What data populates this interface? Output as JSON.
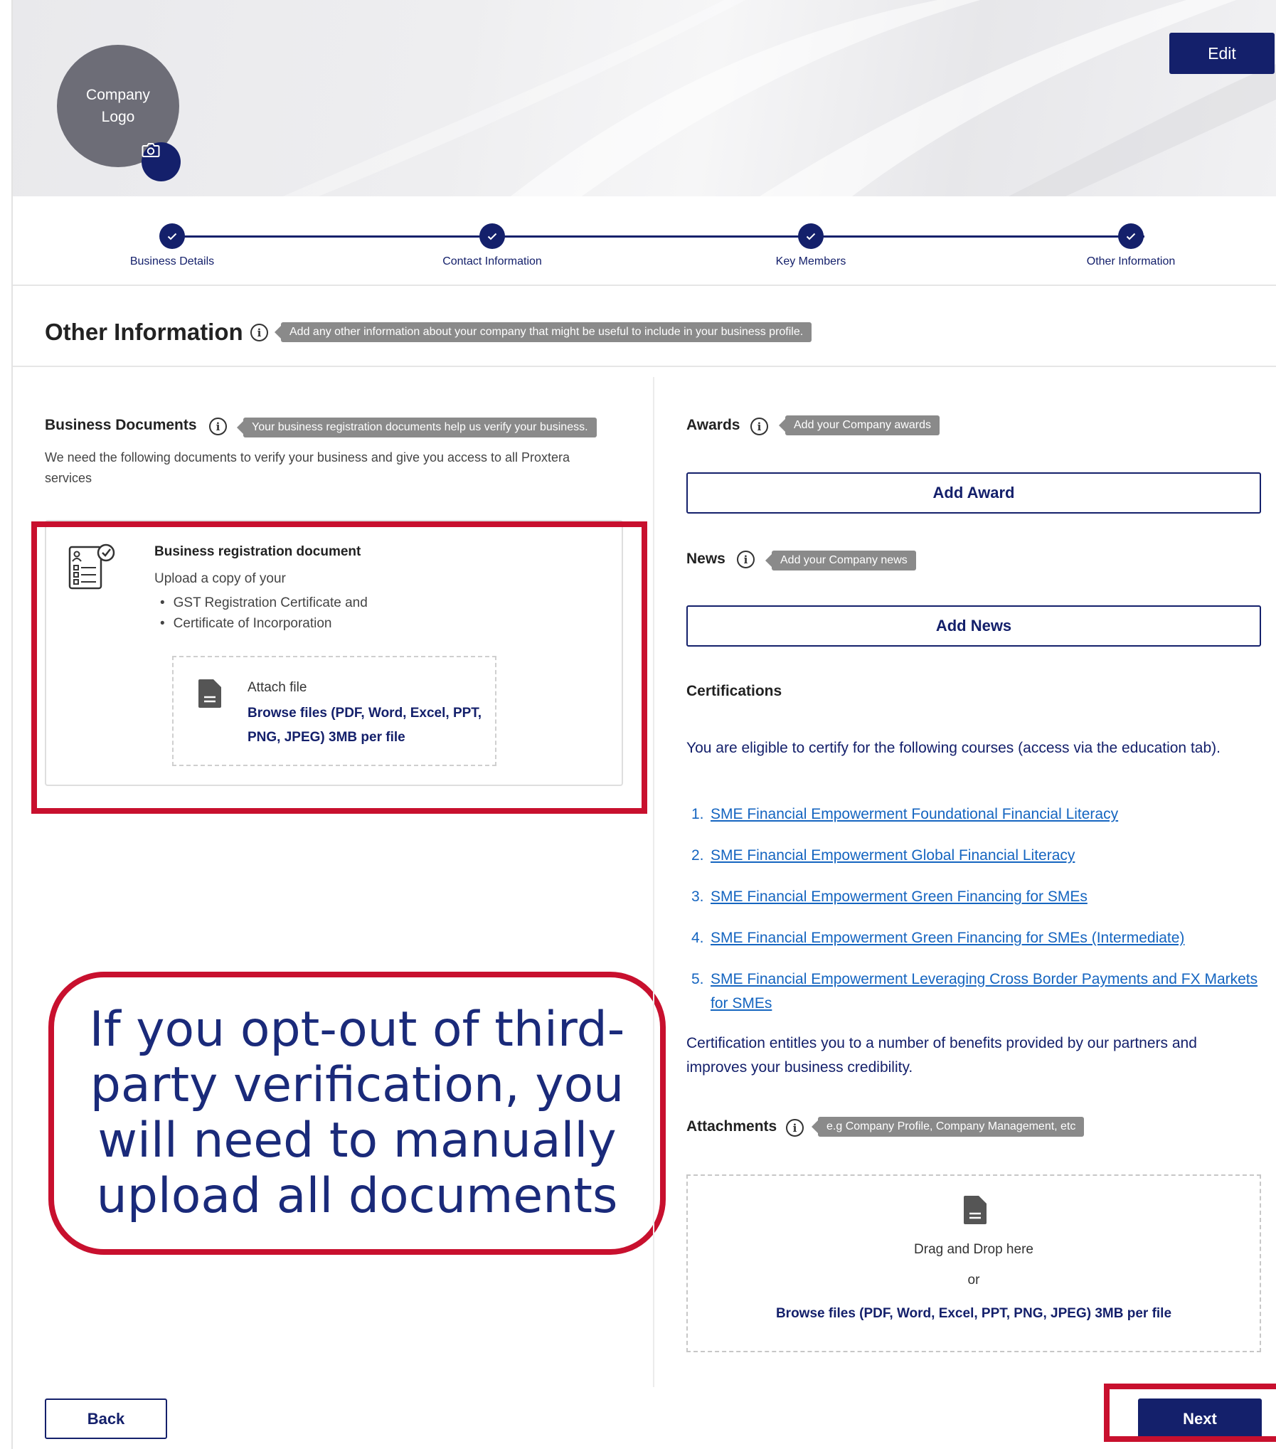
{
  "header": {
    "logo_text": "Company Logo",
    "edit_label": "Edit"
  },
  "stepper": {
    "steps": [
      {
        "label": "Business Details"
      },
      {
        "label": "Contact Information"
      },
      {
        "label": "Key Members"
      },
      {
        "label": "Other Information"
      }
    ]
  },
  "section": {
    "title": "Other Information",
    "tooltip": "Add any other information about your company that might be useful to include in your business profile."
  },
  "business_documents": {
    "title": "Business Documents",
    "tooltip": "Your business registration documents help us verify your business.",
    "description": "We need the following documents to verify your business and give you access to all Proxtera services",
    "card": {
      "title": "Business registration document",
      "subtitle": "Upload a copy of your",
      "items": [
        "GST Registration Certificate and",
        "Certificate of Incorporation"
      ],
      "attach_label": "Attach file",
      "attach_link": "Browse files (PDF, Word, Excel, PPT, PNG, JPEG) 3MB per file"
    }
  },
  "callout": {
    "text": "If you opt-out of third-party verification, you will need to manually upload all documents"
  },
  "awards": {
    "title": "Awards",
    "tooltip": "Add your Company awards",
    "button": "Add Award"
  },
  "news": {
    "title": "News",
    "tooltip": "Add your Company news",
    "button": "Add News"
  },
  "certifications": {
    "title": "Certifications",
    "intro": "You are eligible to certify for the following courses (access via the education tab).",
    "courses": [
      "SME Financial Empowerment Foundational Financial Literacy",
      "SME Financial Empowerment Global Financial Literacy",
      "SME Financial Empowerment Green Financing for SMEs",
      "SME Financial Empowerment Green Financing for SMEs (Intermediate)",
      "SME Financial Empowerment Leveraging Cross Border Payments and FX Markets for SMEs"
    ],
    "footer": "Certification entitles you to a number of benefits provided by our partners and improves your business credibility."
  },
  "attachments": {
    "title": "Attachments",
    "tooltip": "e.g Company Profile, Company Management, etc",
    "drop_text": "Drag and Drop here",
    "or_text": "or",
    "browse_link": "Browse files (PDF, Word, Excel, PPT, PNG, JPEG) 3MB per file"
  },
  "footer": {
    "back_label": "Back",
    "next_label": "Next"
  },
  "colors": {
    "primary": "#14206b",
    "highlight": "#c8102e",
    "link": "#1565c0"
  }
}
